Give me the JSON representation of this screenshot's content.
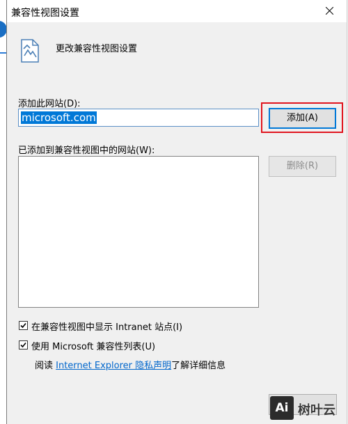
{
  "window": {
    "title": "兼容性视图设置"
  },
  "header": {
    "text": "更改兼容性视图设置",
    "icon": "compat-view-page-icon"
  },
  "add_section": {
    "label": "添加此网站(D):",
    "input_value": "microsoft.com",
    "add_button": "添加(A)"
  },
  "list_section": {
    "label": "已添加到兼容性视图中的网站(W):",
    "items": [],
    "remove_button": "删除(R)"
  },
  "options": {
    "intranet_label": "在兼容性视图中显示 Intranet 站点(I)",
    "intranet_checked": true,
    "ms_list_label": "使用 Microsoft 兼容性列表(U)",
    "ms_list_checked": true
  },
  "privacy": {
    "prefix": "阅读 ",
    "link": "Internet Explorer 隐私声明",
    "suffix": "了解详细信息"
  },
  "watermark": {
    "logo": "Ai",
    "text": "树叶云"
  },
  "colors": {
    "accent": "#0078d7",
    "highlight": "#e0141e",
    "link": "#0066cc"
  }
}
